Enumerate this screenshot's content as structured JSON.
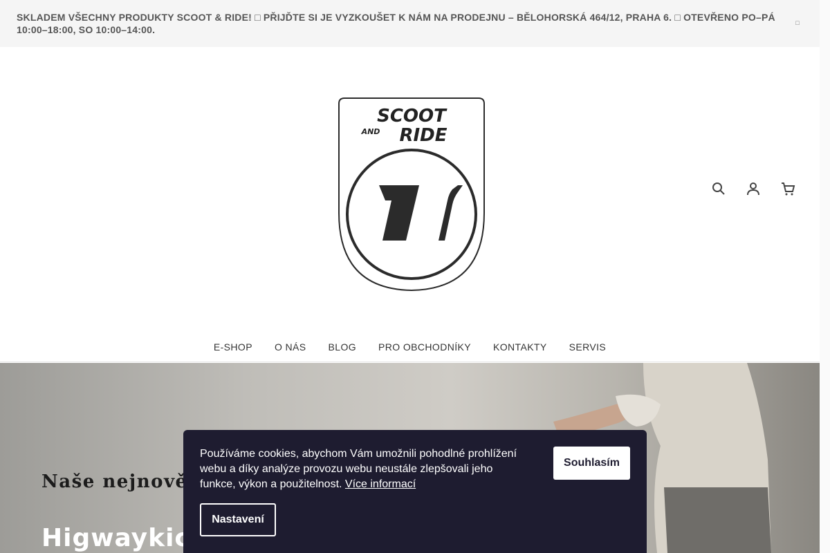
{
  "announcement": {
    "text": "SKLADEM VŠECHNY PRODUKTY SCOOT & RIDE! □ PŘIJĎTE SI JE VYZKOUŠET K NÁM NA PRODEJNU – BĚLOHORSKÁ 464/12, PRAHA 6. □ OTEVŘENO PO–PÁ 10:00–18:00, SO 10:00–14:00.",
    "close_icon": "close-icon"
  },
  "logo": {
    "line1": "SCOOT",
    "line2": "AND",
    "line3": "RIDE"
  },
  "header_icons": [
    "search-icon",
    "user-icon",
    "cart-icon"
  ],
  "nav": {
    "items": [
      "E-SHOP",
      "O NÁS",
      "BLOG",
      "PRO OBCHODNÍKY",
      "KONTAKTY",
      "SERVIS"
    ]
  },
  "hero": {
    "heading": "Naše nejnovější",
    "product": "Higwaykick"
  },
  "cookie": {
    "text": "Používáme cookies, abychom Vám umožnili pohodlné prohlížení webu a díky analýze provozu webu neustále zlepšovali jeho funkce, výkon a použitelnost.",
    "link": "Více informací",
    "accept": "Souhlasím",
    "settings": "Nastavení"
  },
  "colors": {
    "cookie_bg": "#1e1c30",
    "announce_bg": "#f5f5f5",
    "text": "#333333"
  }
}
